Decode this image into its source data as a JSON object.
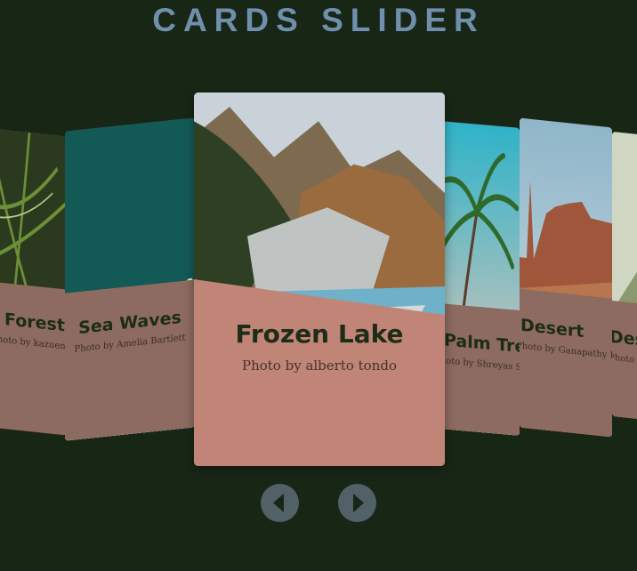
{
  "header": {
    "title": "CARDS SLIDER"
  },
  "cards": [
    {
      "title": "Forest",
      "credit": "Photo by kazuend"
    },
    {
      "title": "Sea Waves",
      "credit": "Photo by Amelia Bartlett"
    },
    {
      "title": "Frozen Lake",
      "credit": "Photo by alberto tondo"
    },
    {
      "title": "Palm Trees",
      "credit": "Photo by Shreyas Sane"
    },
    {
      "title": "Desert",
      "credit": "Photo by Ganapathy Kumar"
    },
    {
      "title": "Desert Canyon",
      "credit": "Photo by Patrick"
    }
  ],
  "controls": {
    "prev_icon": "chevron-left-icon",
    "next_icon": "chevron-right-icon"
  },
  "colors": {
    "background": "#182616",
    "title": "#6f8fad",
    "card_body": "#c08577",
    "side_card_body": "#8e6b60",
    "nav": "#516167"
  }
}
